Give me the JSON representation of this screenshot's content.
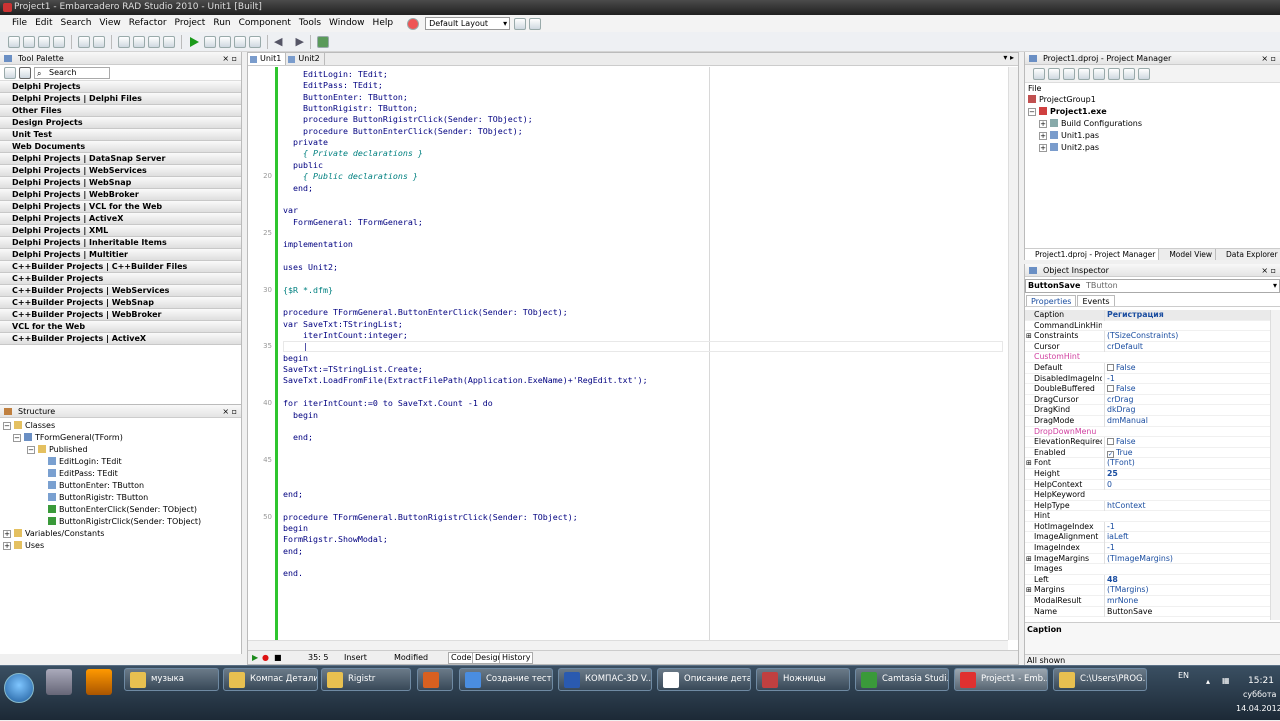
{
  "window": {
    "title": "Project1 - Embarcadero RAD Studio 2010 - Unit1 [Built]"
  },
  "menu": [
    "File",
    "Edit",
    "Search",
    "View",
    "Refactor",
    "Project",
    "Run",
    "Component",
    "Tools",
    "Window",
    "Help"
  ],
  "layout_select": "Default Layout",
  "palette": {
    "title": "Tool Palette",
    "search_placeholder": "Search",
    "categories": [
      "Delphi Projects",
      "Delphi Projects | Delphi Files",
      "Other Files",
      "Design Projects",
      "Unit Test",
      "Web Documents",
      "Delphi Projects | DataSnap Server",
      "Delphi Projects | WebServices",
      "Delphi Projects | WebSnap",
      "Delphi Projects | WebBroker",
      "Delphi Projects | VCL for the Web",
      "Delphi Projects | ActiveX",
      "Delphi Projects | XML",
      "Delphi Projects | Inheritable Items",
      "Delphi Projects | Multitier",
      "C++Builder Projects | C++Builder Files",
      "C++Builder Projects",
      "C++Builder Projects | WebServices",
      "C++Builder Projects | WebSnap",
      "C++Builder Projects | WebBroker",
      "VCL for the Web",
      "C++Builder Projects | ActiveX"
    ]
  },
  "structure": {
    "title": "Structure",
    "nodes": [
      "Classes",
      "TFormGeneral(TForm)",
      "Published",
      "EditLogin: TEdit",
      "EditPass: TEdit",
      "ButtonEnter: TButton",
      "ButtonRigistr: TButton",
      "ButtonEnterClick(Sender: TObject)",
      "ButtonRigistrClick(Sender: TObject)",
      "Variables/Constants",
      "Uses"
    ]
  },
  "editor": {
    "tabs": [
      "Unit1",
      "Unit2"
    ],
    "line_numbers": [
      "20",
      "25",
      "30",
      "35",
      "40",
      "45",
      "50"
    ],
    "code": [
      "    EditLogin: TEdit;",
      "    EditPass: TEdit;",
      "    ButtonEnter: TButton;",
      "    ButtonRigistr: TButton;",
      "    procedure ButtonRigistrClick(Sender: TObject);",
      "    procedure ButtonEnterClick(Sender: TObject);",
      "  private",
      "    { Private declarations }",
      "  public",
      "    { Public declarations }",
      "  end;",
      "",
      "var",
      "  FormGeneral: TFormGeneral;",
      "",
      "implementation",
      "",
      "uses Unit2;",
      "",
      "{$R *.dfm}",
      "",
      "procedure TFormGeneral.ButtonEnterClick(Sender: TObject);",
      "var SaveTxt:TStringList;",
      "    iterIntCount:integer;",
      "    |",
      "begin",
      "SaveTxt:=TStringList.Create;",
      "SaveTxt.LoadFromFile(ExtractFilePath(Application.ExeName)+'RegEdit.txt');",
      "",
      "for iterIntCount:=0 to SaveTxt.Count -1 do",
      "  begin",
      "",
      "  end;",
      "",
      "",
      "",
      "",
      "end;",
      "",
      "procedure TFormGeneral.ButtonRigistrClick(Sender: TObject);",
      "begin",
      "FormRigstr.ShowModal;",
      "end;",
      "",
      "end."
    ],
    "status": {
      "position": "35: 5",
      "mode": "Insert",
      "state": "Modified",
      "view_tabs": [
        "Code",
        "Design",
        "History"
      ]
    }
  },
  "project_manager": {
    "title": "Project1.dproj - Project Manager",
    "file_label": "File",
    "tree": [
      "ProjectGroup1",
      "Project1.exe",
      "Build Configurations",
      "Unit1.pas",
      "Unit2.pas"
    ],
    "tabs": [
      "Project1.dproj - Project Manager",
      "Model View",
      "Data Explorer"
    ]
  },
  "object_inspector": {
    "title": "Object Inspector",
    "selected": "ButtonSave",
    "selected_type": "TButton",
    "tabs": [
      "Properties",
      "Events"
    ],
    "props": [
      {
        "name": "Caption",
        "value": "Регистрация",
        "style": "bold"
      },
      {
        "name": "CommandLinkHint",
        "value": ""
      },
      {
        "name": "Constraints",
        "value": "(TSizeConstraints)",
        "exp": "+"
      },
      {
        "name": "Cursor",
        "value": "crDefault"
      },
      {
        "name": "CustomHint",
        "value": "",
        "red": true
      },
      {
        "name": "Default",
        "value": "False",
        "chk": " "
      },
      {
        "name": "DisabledImageIndex",
        "value": "-1"
      },
      {
        "name": "DoubleBuffered",
        "value": "False",
        "chk": " "
      },
      {
        "name": "DragCursor",
        "value": "crDrag"
      },
      {
        "name": "DragKind",
        "value": "dkDrag"
      },
      {
        "name": "DragMode",
        "value": "dmManual"
      },
      {
        "name": "DropDownMenu",
        "value": "",
        "red": true
      },
      {
        "name": "ElevationRequired",
        "value": "False",
        "chk": " "
      },
      {
        "name": "Enabled",
        "value": "True",
        "chk": "✓"
      },
      {
        "name": "Font",
        "value": "(TFont)",
        "exp": "+"
      },
      {
        "name": "Height",
        "value": "25",
        "style": "bold"
      },
      {
        "name": "HelpContext",
        "value": "0"
      },
      {
        "name": "HelpKeyword",
        "value": ""
      },
      {
        "name": "HelpType",
        "value": "htContext"
      },
      {
        "name": "Hint",
        "value": ""
      },
      {
        "name": "HotImageIndex",
        "value": "-1"
      },
      {
        "name": "ImageAlignment",
        "value": "iaLeft"
      },
      {
        "name": "ImageIndex",
        "value": "-1"
      },
      {
        "name": "ImageMargins",
        "value": "(TImageMargins)",
        "exp": "+"
      },
      {
        "name": "Images",
        "value": ""
      },
      {
        "name": "Left",
        "value": "48",
        "style": "bold"
      },
      {
        "name": "Margins",
        "value": "(TMargins)",
        "exp": "+"
      },
      {
        "name": "ModalResult",
        "value": "mrNone"
      },
      {
        "name": "Name",
        "value": "ButtonSave"
      }
    ],
    "description": "Caption",
    "filter": "All shown"
  },
  "taskbar": {
    "tasks": [
      "музыка",
      "Компас Детали",
      "Rigistr",
      "",
      "Создание тест...",
      "КОМПАС-3D V...",
      "Описание дета...",
      "Ножницы",
      "Camtasia Studi...",
      "Project1 - Emb...",
      "C:\\Users\\PROG..."
    ],
    "lang": "EN",
    "time": "15:21",
    "day": "суббота",
    "date": "14.04.2012"
  }
}
